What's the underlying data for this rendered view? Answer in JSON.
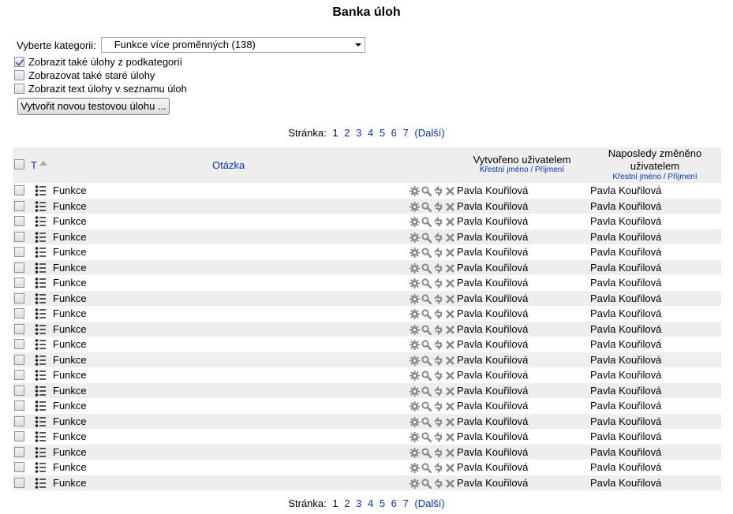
{
  "page_title": "Banka úloh",
  "category": {
    "label": "Vyberte kategorii:",
    "selected": "Funkce více proměnných (138)"
  },
  "options": [
    {
      "label": "Zobrazit také úlohy z podkategorií",
      "checked": true
    },
    {
      "label": "Zobrazovat také staré úlohy",
      "checked": false
    },
    {
      "label": "Zobrazit text úlohy v seznamu úloh",
      "checked": false
    }
  ],
  "create_button": "Vytvořit novou testovou úlohu ...",
  "pager": {
    "label": "Stránka:",
    "current": "1",
    "pages": [
      "2",
      "3",
      "4",
      "5",
      "6",
      "7"
    ],
    "next": "(Další)"
  },
  "table": {
    "col_type": "T",
    "col_question": "Otázka",
    "col_created": "Vytvořeno uživatelem",
    "col_created_sub_first": "Křestní jméno",
    "col_created_sub_sep": " / ",
    "col_created_sub_last": "Příjmení",
    "col_modified_line1": "Naposledy změněno",
    "col_modified_line2": "uživatelem",
    "col_modified_sub_first": "Křestní jméno",
    "col_modified_sub_sep": " / ",
    "col_modified_sub_last": "Příjmení",
    "rows": [
      {
        "name": "Funkce",
        "created": "Pavla Kouřilová",
        "modified": "Pavla Kouřilová"
      },
      {
        "name": "Funkce",
        "created": "Pavla Kouřilová",
        "modified": "Pavla Kouřilová"
      },
      {
        "name": "Funkce",
        "created": "Pavla Kouřilová",
        "modified": "Pavla Kouřilová"
      },
      {
        "name": "Funkce",
        "created": "Pavla Kouřilová",
        "modified": "Pavla Kouřilová"
      },
      {
        "name": "Funkce",
        "created": "Pavla Kouřilová",
        "modified": "Pavla Kouřilová"
      },
      {
        "name": "Funkce",
        "created": "Pavla Kouřilová",
        "modified": "Pavla Kouřilová"
      },
      {
        "name": "Funkce",
        "created": "Pavla Kouřilová",
        "modified": "Pavla Kouřilová"
      },
      {
        "name": "Funkce",
        "created": "Pavla Kouřilová",
        "modified": "Pavla Kouřilová"
      },
      {
        "name": "Funkce",
        "created": "Pavla Kouřilová",
        "modified": "Pavla Kouřilová"
      },
      {
        "name": "Funkce",
        "created": "Pavla Kouřilová",
        "modified": "Pavla Kouřilová"
      },
      {
        "name": "Funkce",
        "created": "Pavla Kouřilová",
        "modified": "Pavla Kouřilová"
      },
      {
        "name": "Funkce",
        "created": "Pavla Kouřilová",
        "modified": "Pavla Kouřilová"
      },
      {
        "name": "Funkce",
        "created": "Pavla Kouřilová",
        "modified": "Pavla Kouřilová"
      },
      {
        "name": "Funkce",
        "created": "Pavla Kouřilová",
        "modified": "Pavla Kouřilová"
      },
      {
        "name": "Funkce",
        "created": "Pavla Kouřilová",
        "modified": "Pavla Kouřilová"
      },
      {
        "name": "Funkce",
        "created": "Pavla Kouřilová",
        "modified": "Pavla Kouřilová"
      },
      {
        "name": "Funkce",
        "created": "Pavla Kouřilová",
        "modified": "Pavla Kouřilová"
      },
      {
        "name": "Funkce",
        "created": "Pavla Kouřilová",
        "modified": "Pavla Kouřilová"
      },
      {
        "name": "Funkce",
        "created": "Pavla Kouřilová",
        "modified": "Pavla Kouřilová"
      },
      {
        "name": "Funkce",
        "created": "Pavla Kouřilová",
        "modified": "Pavla Kouřilová"
      }
    ]
  },
  "icons": {
    "type": "question-type-icon",
    "actions": [
      "gear-icon",
      "preview-icon",
      "move-icon",
      "delete-icon"
    ]
  },
  "colors": {
    "link": "#0033cc",
    "row_alt": "#eeeeee",
    "icon_gray": "#8a8a8a"
  }
}
